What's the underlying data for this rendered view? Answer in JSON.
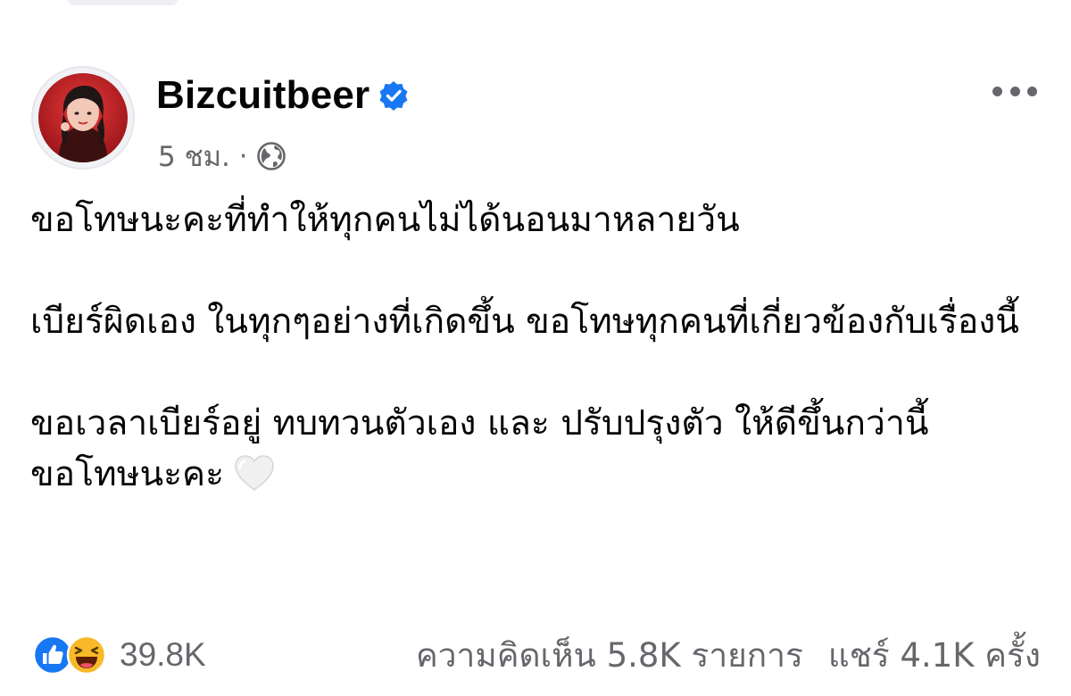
{
  "author": {
    "name": "Bizcuitbeer",
    "verified": true
  },
  "meta": {
    "time": "5 ชม.",
    "separator": "·",
    "audience_icon": "globe-icon"
  },
  "body": {
    "paragraphs": [
      "ขอโทษนะคะที่ทำให้ทุกคนไม่ได้นอนมาหลายวัน",
      "เบียร์ผิดเอง ในทุกๆอย่างที่เกิดขึ้น ขอโทษทุกคนที่เกี่ยวข้องกับเรื่องนี้",
      "ขอเวลาเบียร์อยู่ ทบทวนตัวเอง และ ปรับปรุงตัว ให้ดีขึ้นกว่านี้ ขอโทษนะคะ"
    ],
    "trailing_emoji": "white-heart-icon"
  },
  "footer": {
    "reaction_icons": [
      "like-icon",
      "haha-icon"
    ],
    "reaction_count": "39.8K",
    "comments": "ความคิดเห็น 5.8K รายการ",
    "shares": "แชร์ 4.1K ครั้ง"
  },
  "colors": {
    "verified_blue": "#1877f2",
    "secondary_text": "#65676b",
    "primary_text": "#050505",
    "like_blue": "#1877f2",
    "haha_yellow": "#f7b928"
  }
}
